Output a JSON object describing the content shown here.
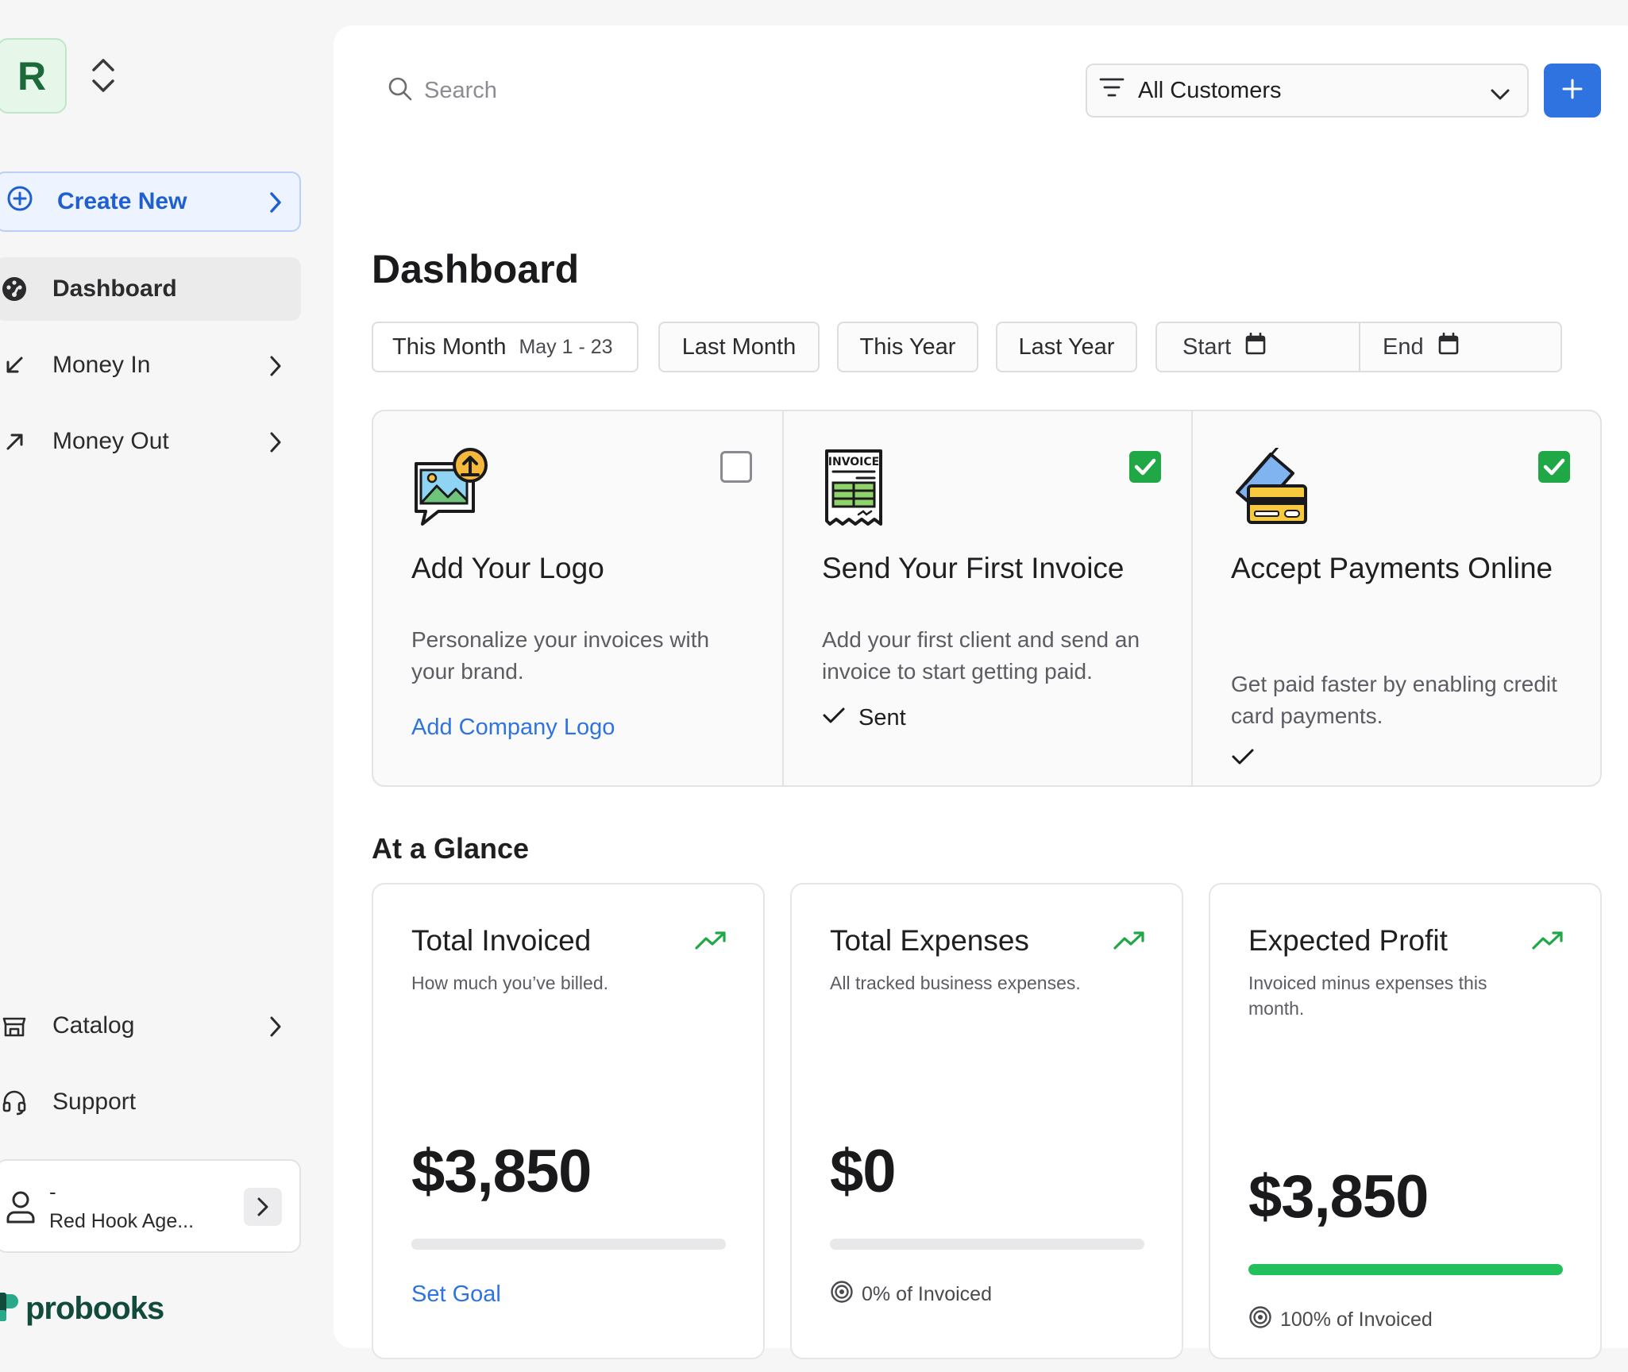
{
  "sidebar": {
    "org_initial": "R",
    "create_new_label": "Create New",
    "nav_items": [
      {
        "label": "Dashboard",
        "icon": "dashboard-icon",
        "active": true
      },
      {
        "label": "Money In",
        "icon": "arrow-down-left-icon"
      },
      {
        "label": "Money Out",
        "icon": "arrow-up-right-icon"
      }
    ],
    "bottom_items": [
      {
        "label": "Catalog",
        "icon": "storefront-icon"
      },
      {
        "label": "Support",
        "icon": "headset-icon"
      }
    ],
    "user": {
      "line1": "-",
      "name": "Red Hook Age..."
    },
    "brand": "probooks"
  },
  "header": {
    "search_placeholder": "Search",
    "customer_filter": "All Customers"
  },
  "page_title": "Dashboard",
  "date_filters": {
    "this_month": "This Month",
    "this_month_range": "May 1 - 23",
    "last_month": "Last Month",
    "this_year": "This Year",
    "last_year": "Last Year",
    "start": "Start",
    "end": "End"
  },
  "setup_steps": [
    {
      "title": "Add Your Logo",
      "description": "Personalize your invoices with your brand.",
      "action": "Add Company Logo",
      "done": false
    },
    {
      "title": "Send Your First Invoice",
      "description": "Add your first client and send an invoice to start getting paid.",
      "status": "Sent",
      "done": true
    },
    {
      "title": "Accept Payments Online",
      "description": "Get paid faster by enabling credit card payments.",
      "status": "",
      "done": true
    }
  ],
  "glance": {
    "title": "At a Glance",
    "cards": [
      {
        "title": "Total Invoiced",
        "subtitle": "How much you’ve billed.",
        "value": "$3,850",
        "progress": 0,
        "link": "Set Goal"
      },
      {
        "title": "Total Expenses",
        "subtitle": "All tracked business expenses.",
        "value": "$0",
        "progress": 0,
        "pct_label": "0% of Invoiced"
      },
      {
        "title": "Expected Profit",
        "subtitle": "Invoiced minus expenses this month.",
        "value": "$3,850",
        "progress": 1.0,
        "pct_label": "100% of Invoiced"
      }
    ]
  },
  "colors": {
    "accent": "#2f73e0",
    "success": "#1fa845",
    "progress_fill": "#22c05a",
    "trend": "#1fa845"
  }
}
